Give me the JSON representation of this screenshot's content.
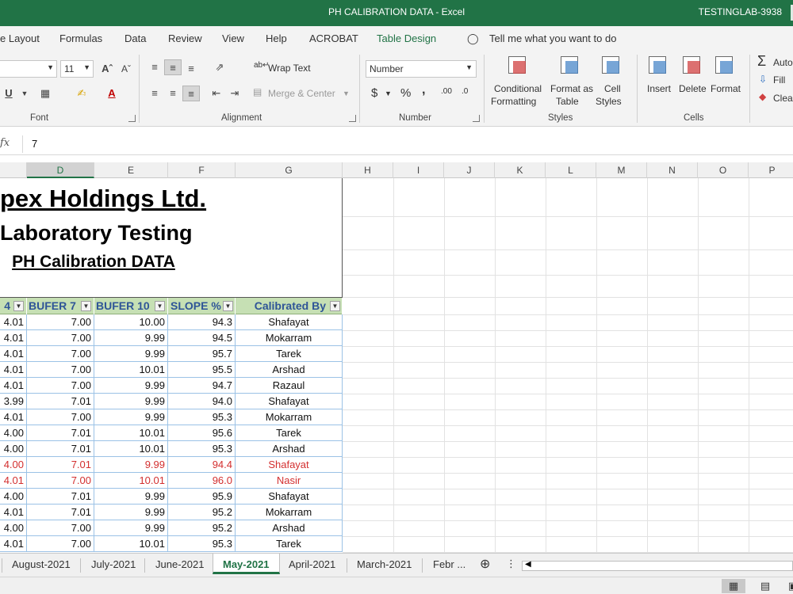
{
  "titlebar": {
    "doc_title": "PH CALIBRATION DATA  -  Excel",
    "user": "TESTINGLAB-3938"
  },
  "ribbon_tabs": [
    "e Layout",
    "Formulas",
    "Data",
    "Review",
    "View",
    "Help",
    "ACROBAT",
    "Table Design",
    "Tell me what you want to do"
  ],
  "ribbon": {
    "font_size": "11",
    "underline": "U",
    "font_group": "Font",
    "wrap_text": "Wrap Text",
    "merge_center": "Merge & Center",
    "alignment_group": "Alignment",
    "number_format": "Number",
    "currency": "$",
    "percent": "%",
    "comma": ",",
    "inc_decimal": ".00",
    "dec_decimal": ".0",
    "number_group": "Number",
    "conditional_formatting": [
      "Conditional",
      "Formatting"
    ],
    "format_as_table": [
      "Format as",
      "Table"
    ],
    "cell_styles": [
      "Cell",
      "Styles"
    ],
    "styles_group": "Styles",
    "insert": "Insert",
    "delete": "Delete",
    "format": "Format",
    "cells_group": "Cells",
    "autosum": "Auto",
    "fill": "Fill",
    "clear": "Clear"
  },
  "formula_bar": {
    "fx": "fx",
    "value": "7"
  },
  "columns": [
    "D",
    "E",
    "F",
    "G",
    "H",
    "I",
    "J",
    "K",
    "L",
    "M",
    "N",
    "O",
    "P"
  ],
  "sheet": {
    "title1": "pex Holdings Ltd.",
    "title2": "Laboratory Testing",
    "title3": "PH Calibration DATA",
    "headers": [
      "4",
      "BUFER 7",
      "BUFER 10",
      "SLOPE %",
      "Calibrated By"
    ],
    "rows": [
      [
        "4.01",
        "7.00",
        "10.00",
        "94.3",
        "Shafayat"
      ],
      [
        "4.01",
        "7.00",
        "9.99",
        "94.5",
        "Mokarram"
      ],
      [
        "4.01",
        "7.00",
        "9.99",
        "95.7",
        "Tarek"
      ],
      [
        "4.01",
        "7.00",
        "10.01",
        "95.5",
        "Arshad"
      ],
      [
        "4.01",
        "7.00",
        "9.99",
        "94.7",
        "Razaul"
      ],
      [
        "3.99",
        "7.01",
        "9.99",
        "94.0",
        "Shafayat"
      ],
      [
        "4.01",
        "7.00",
        "9.99",
        "95.3",
        "Mokarram"
      ],
      [
        "4.00",
        "7.01",
        "10.01",
        "95.6",
        "Tarek"
      ],
      [
        "4.00",
        "7.01",
        "10.01",
        "95.3",
        "Arshad"
      ],
      [
        "4.00",
        "7.01",
        "9.99",
        "94.4",
        "Shafayat"
      ],
      [
        "4.01",
        "7.00",
        "10.01",
        "96.0",
        "Nasir"
      ],
      [
        "4.00",
        "7.01",
        "9.99",
        "95.9",
        "Shafayat"
      ],
      [
        "4.01",
        "7.01",
        "9.99",
        "95.2",
        "Mokarram"
      ],
      [
        "4.00",
        "7.00",
        "9.99",
        "95.2",
        "Arshad"
      ],
      [
        "4.01",
        "7.00",
        "10.01",
        "95.3",
        "Tarek"
      ]
    ],
    "red_rows": [
      9,
      10
    ],
    "text_color_red": "#d32f2f",
    "header_fill": "#c6e0b4"
  },
  "sheet_tabs": [
    "August-2021",
    "July-2021",
    "June-2021",
    "May-2021",
    "April-2021",
    "March-2021",
    "Febr ..."
  ],
  "active_sheet": "May-2021",
  "colors": {
    "excel_green": "#217346"
  }
}
